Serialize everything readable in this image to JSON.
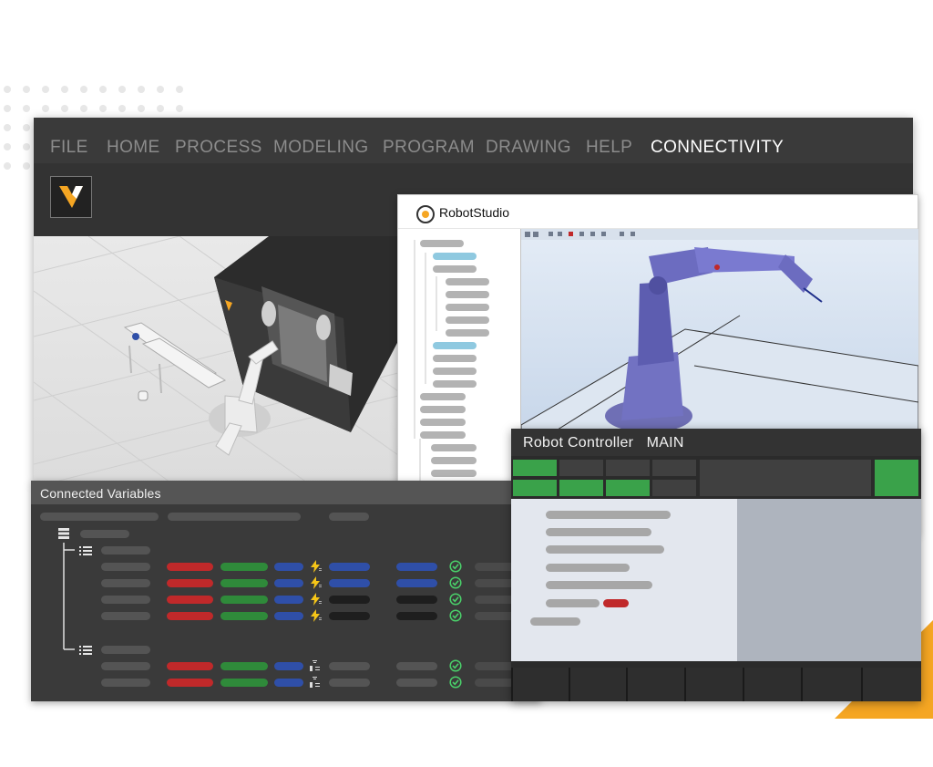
{
  "menu": {
    "items": [
      {
        "label": "FILE",
        "active": false
      },
      {
        "label": "HOME",
        "active": false
      },
      {
        "label": "PROCESS",
        "active": false
      },
      {
        "label": "MODELING",
        "active": false
      },
      {
        "label": "PROGRAM",
        "active": false
      },
      {
        "label": "DRAWING",
        "active": false
      },
      {
        "label": "HELP",
        "active": false
      },
      {
        "label": "CONNECTIVITY",
        "active": true
      }
    ]
  },
  "robotstudio": {
    "title": "RobotStudio"
  },
  "connected_variables": {
    "title": "Connected Variables",
    "row_icons": [
      "bolt-icon",
      "bolt-icon",
      "bolt-icon",
      "bolt-icon",
      "bit-icon",
      "bit-icon"
    ],
    "status": [
      "check-icon",
      "check-icon",
      "check-icon",
      "check-icon",
      "check-icon",
      "check-icon"
    ]
  },
  "robot_controller": {
    "title": "Robot Controller",
    "task": "MAIN"
  },
  "colors": {
    "accent": "#f5a623",
    "active_green": "#3aa24a",
    "value_red": "#c0292a",
    "value_green": "#2f8a3a",
    "value_blue": "#2f4fa8",
    "tree_highlight": "#8fc9e0"
  }
}
